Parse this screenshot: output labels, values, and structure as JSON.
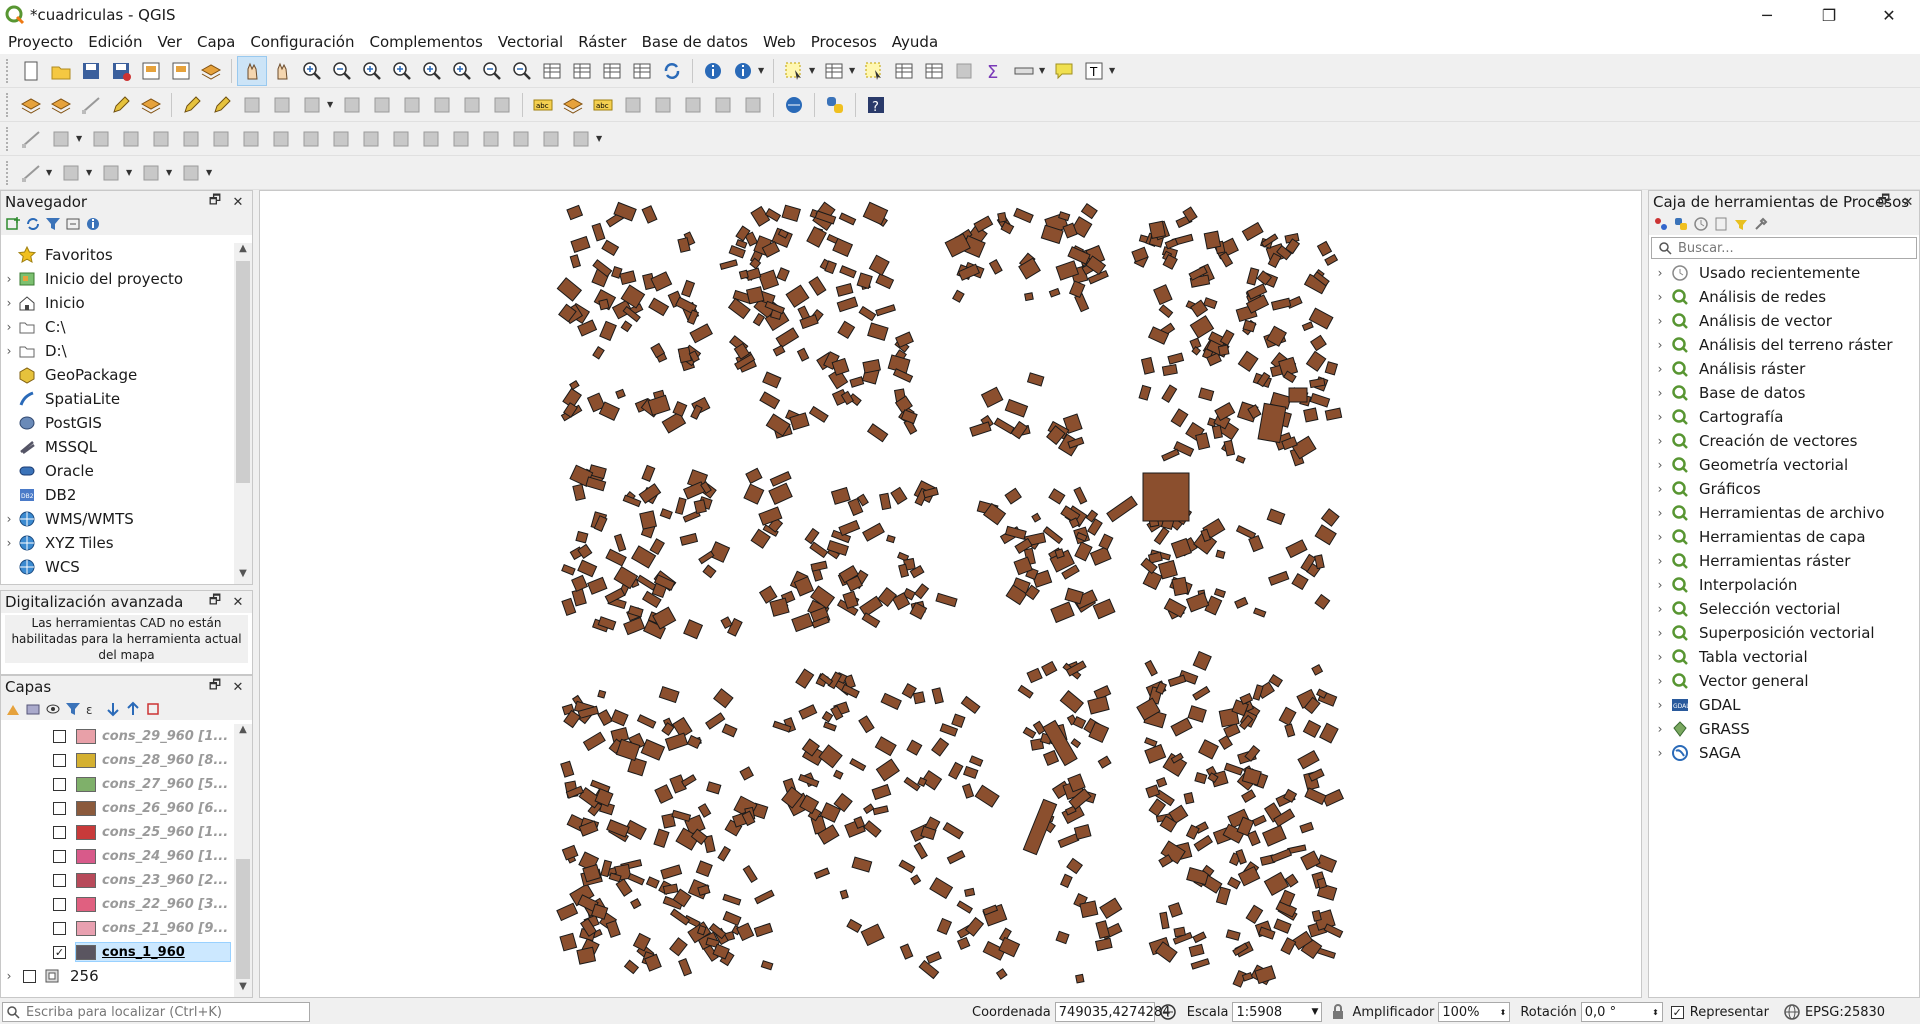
{
  "window": {
    "title": "*cuadriculas - QGIS",
    "minimize_glyph": "─",
    "restore_glyph": "❐",
    "close_glyph": "✕"
  },
  "menu": [
    "Proyecto",
    "Edición",
    "Ver",
    "Capa",
    "Configuración",
    "Complementos",
    "Vectorial",
    "Ráster",
    "Base de datos",
    "Web",
    "Procesos",
    "Ayuda"
  ],
  "navigator": {
    "title": "Navegador",
    "items": [
      {
        "label": "Favoritos",
        "icon": "star-icon",
        "expandable": false
      },
      {
        "label": "Inicio del proyecto",
        "icon": "project-home-icon",
        "expandable": true
      },
      {
        "label": "Inicio",
        "icon": "home-icon",
        "expandable": true
      },
      {
        "label": "C:\\",
        "icon": "folder-icon",
        "expandable": true
      },
      {
        "label": "D:\\",
        "icon": "folder-icon",
        "expandable": true
      },
      {
        "label": "GeoPackage",
        "icon": "geopackage-icon",
        "expandable": false
      },
      {
        "label": "SpatiaLite",
        "icon": "spatialite-icon",
        "expandable": false
      },
      {
        "label": "PostGIS",
        "icon": "postgis-icon",
        "expandable": false
      },
      {
        "label": "MSSQL",
        "icon": "mssql-icon",
        "expandable": false
      },
      {
        "label": "Oracle",
        "icon": "oracle-icon",
        "expandable": false
      },
      {
        "label": "DB2",
        "icon": "db2-icon",
        "expandable": false
      },
      {
        "label": "WMS/WMTS",
        "icon": "globe-icon",
        "expandable": true
      },
      {
        "label": "XYZ Tiles",
        "icon": "globe-icon",
        "expandable": true
      },
      {
        "label": "WCS",
        "icon": "globe-icon",
        "expandable": false
      }
    ]
  },
  "advanced_digitizing": {
    "title": "Digitalización avanzada",
    "message": "Las herramientas CAD no están habilitadas para la herramienta actual del mapa"
  },
  "layers": {
    "title": "Capas",
    "items": [
      {
        "name": "cons_29_960 [1...",
        "color": "#e8a0a8",
        "checked": false
      },
      {
        "name": "cons_28_960 [8...",
        "color": "#d4b030",
        "checked": false
      },
      {
        "name": "cons_27_960 [5...",
        "color": "#7fb06a",
        "checked": false
      },
      {
        "name": "cons_26_960 [6...",
        "color": "#8b5a3c",
        "checked": false
      },
      {
        "name": "cons_25_960 [1...",
        "color": "#c83a3a",
        "checked": false
      },
      {
        "name": "cons_24_960 [1...",
        "color": "#d85a8a",
        "checked": false
      },
      {
        "name": "cons_23_960 [2...",
        "color": "#b84a5a",
        "checked": false
      },
      {
        "name": "cons_22_960 [3...",
        "color": "#e06080",
        "checked": false
      },
      {
        "name": "cons_21_960 [9...",
        "color": "#e8a0b0",
        "checked": false
      },
      {
        "name": "cons_1_960",
        "color": "#5a5560",
        "checked": true
      }
    ],
    "group": {
      "name": "256"
    }
  },
  "processing": {
    "title": "Caja de herramientas de Procesos",
    "search_placeholder": "Buscar...",
    "items": [
      {
        "label": "Usado recientemente",
        "icon": "clock-icon"
      },
      {
        "label": "Análisis de redes",
        "icon": "qgis-icon"
      },
      {
        "label": "Análisis de vector",
        "icon": "qgis-icon"
      },
      {
        "label": "Análisis del terreno ráster",
        "icon": "qgis-icon"
      },
      {
        "label": "Análisis ráster",
        "icon": "qgis-icon"
      },
      {
        "label": "Base de datos",
        "icon": "qgis-icon"
      },
      {
        "label": "Cartografía",
        "icon": "qgis-icon"
      },
      {
        "label": "Creación de vectores",
        "icon": "qgis-icon"
      },
      {
        "label": "Geometría vectorial",
        "icon": "qgis-icon"
      },
      {
        "label": "Gráficos",
        "icon": "qgis-icon"
      },
      {
        "label": "Herramientas de archivo",
        "icon": "qgis-icon"
      },
      {
        "label": "Herramientas de capa",
        "icon": "qgis-icon"
      },
      {
        "label": "Herramientas ráster",
        "icon": "qgis-icon"
      },
      {
        "label": "Interpolación",
        "icon": "qgis-icon"
      },
      {
        "label": "Selección vectorial",
        "icon": "qgis-icon"
      },
      {
        "label": "Superposición vectorial",
        "icon": "qgis-icon"
      },
      {
        "label": "Tabla vectorial",
        "icon": "qgis-icon"
      },
      {
        "label": "Vector general",
        "icon": "qgis-icon"
      },
      {
        "label": "GDAL",
        "icon": "gdal-icon"
      },
      {
        "label": "GRASS",
        "icon": "grass-icon"
      },
      {
        "label": "SAGA",
        "icon": "saga-icon"
      }
    ]
  },
  "map": {
    "feature_fill": "#8b4f2e",
    "feature_stroke": "#1a1a1a",
    "background": "#ffffff"
  },
  "status": {
    "locator_placeholder": "Escriba para localizar (Ctrl+K)",
    "coord_label": "Coordenada",
    "coord_value": "749035,4274284",
    "scale_label": "Escala",
    "scale_value": "1:5908",
    "magnifier_label": "Amplificador",
    "magnifier_value": "100%",
    "rotation_label": "Rotación",
    "rotation_value": "0,0 °",
    "render_label": "Representar",
    "render_checked": true,
    "crs_value": "EPSG:25830"
  }
}
